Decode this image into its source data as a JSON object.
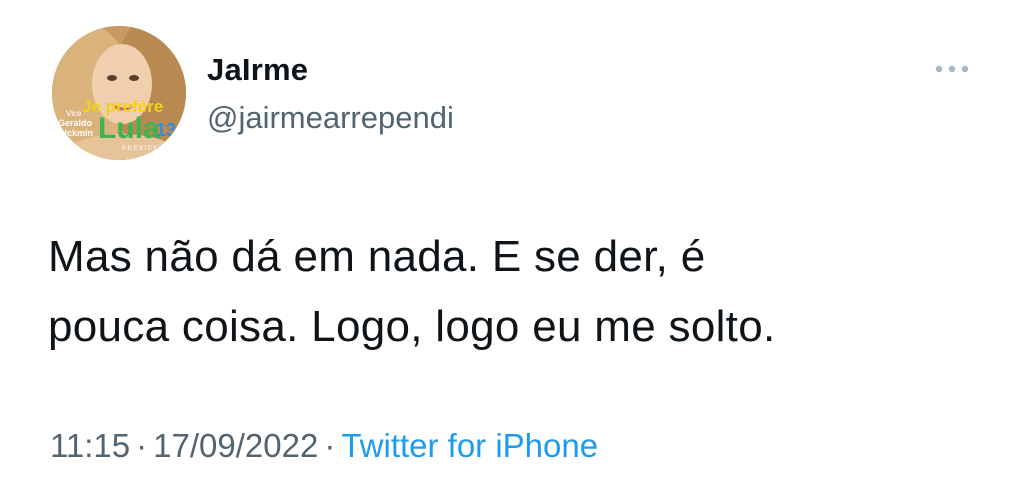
{
  "tweet": {
    "author": {
      "display_name": "JaIrme",
      "handle": "@jairmearrependi",
      "avatar_overlay": {
        "line1": "Je prefère",
        "line2": "Lula",
        "number": "13",
        "vice_label": "Vice",
        "vice_name_1": "Geraldo",
        "vice_name_2": "Alckmin",
        "role": "PRESIDENTE"
      }
    },
    "text": "Mas não dá em nada. E se der, é\npouca coisa. Logo, logo eu me solto.",
    "meta": {
      "time": "11:15",
      "separator": "·",
      "date": "17/09/2022",
      "source": "Twitter for iPhone"
    },
    "colors": {
      "text": "#0f1419",
      "secondary": "#536471",
      "link": "#1d9bf0",
      "overlay_yellow": "#f2d21b",
      "overlay_green": "#3fb34f",
      "overlay_blue": "#2f8fd8"
    },
    "icons": {
      "more": "more-horizontal-icon"
    }
  }
}
